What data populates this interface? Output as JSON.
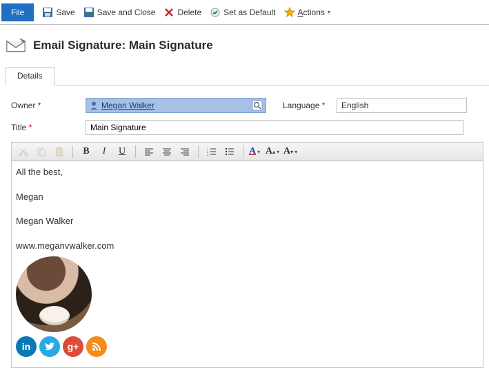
{
  "toolbar": {
    "file": "File",
    "save": "Save",
    "save_close": "Save and Close",
    "delete": "Delete",
    "set_default": "Set as Default",
    "actions": "Actions"
  },
  "header": {
    "title": "Email Signature: Main Signature"
  },
  "tabs": {
    "details": "Details"
  },
  "form": {
    "owner_label": "Owner",
    "owner_value": "Megan Walker",
    "language_label": "Language",
    "language_value": "English",
    "title_label": "Title",
    "title_value": "Main Signature"
  },
  "editor_toolbar": {
    "cut": "cut",
    "copy": "copy",
    "paste": "paste",
    "bold": "B",
    "italic": "I",
    "underline": "U",
    "font_color": "A",
    "font_size": "A",
    "font_clear": "A"
  },
  "signature": {
    "line1": "All the best,",
    "line2": "Megan",
    "line3": "Megan Walker",
    "line4": "www.meganvwalker.com"
  },
  "social": {
    "linkedin": "in",
    "twitter": "twitter",
    "gplus": "g+",
    "rss": "rss"
  }
}
